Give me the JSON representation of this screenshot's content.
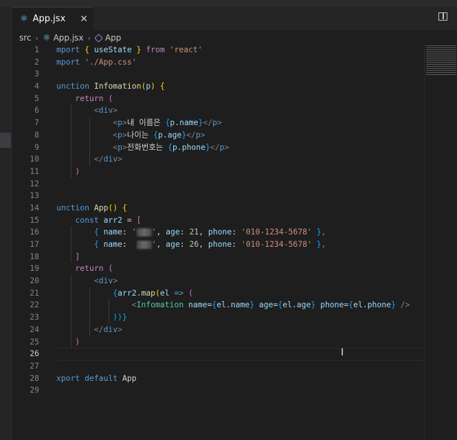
{
  "tab": {
    "icon": "react-icon",
    "label": "App.jsx",
    "close": "✕"
  },
  "breadcrumb": {
    "items": [
      "src",
      "App.jsx",
      "App"
    ]
  },
  "editor": {
    "lines": [
      {
        "num": "1",
        "tokens": [
          [
            "mport ",
            "kw"
          ],
          [
            "{ ",
            "brace"
          ],
          [
            "useState",
            "var"
          ],
          [
            " }",
            "brace"
          ],
          [
            " from ",
            "ctrl"
          ],
          [
            "'react'",
            "str"
          ]
        ]
      },
      {
        "num": "2",
        "tokens": [
          [
            "mport ",
            "kw"
          ],
          [
            "'./App.css'",
            "str"
          ]
        ]
      },
      {
        "num": "3",
        "tokens": []
      },
      {
        "num": "4",
        "tokens": [
          [
            "unction ",
            "kw"
          ],
          [
            "Infomation",
            "fn"
          ],
          [
            "(",
            "brace"
          ],
          [
            "p",
            "var"
          ],
          [
            ")",
            "brace"
          ],
          [
            " {",
            "brace"
          ]
        ]
      },
      {
        "num": "5",
        "tokens": [
          [
            "    return ",
            "ctrl"
          ],
          [
            "(",
            "brace2"
          ]
        ]
      },
      {
        "num": "6",
        "tokens": [
          [
            "        <",
            "punct"
          ],
          [
            "div",
            "tag"
          ],
          [
            ">",
            "punct"
          ]
        ]
      },
      {
        "num": "7",
        "tokens": [
          [
            "            <",
            "punct"
          ],
          [
            "p",
            "tag"
          ],
          [
            ">",
            "punct"
          ],
          [
            "내 이름은 ",
            "text"
          ],
          [
            "{",
            "brace3"
          ],
          [
            "p.name",
            "var"
          ],
          [
            "}",
            "brace3"
          ],
          [
            "</",
            "punct"
          ],
          [
            "p",
            "tag"
          ],
          [
            ">",
            "punct"
          ]
        ]
      },
      {
        "num": "8",
        "tokens": [
          [
            "            <",
            "punct"
          ],
          [
            "p",
            "tag"
          ],
          [
            ">",
            "punct"
          ],
          [
            "나이는 ",
            "text"
          ],
          [
            "{",
            "brace3"
          ],
          [
            "p.age",
            "var"
          ],
          [
            "}",
            "brace3"
          ],
          [
            "</",
            "punct"
          ],
          [
            "p",
            "tag"
          ],
          [
            ">",
            "punct"
          ]
        ]
      },
      {
        "num": "9",
        "tokens": [
          [
            "            <",
            "punct"
          ],
          [
            "p",
            "tag"
          ],
          [
            ">",
            "punct"
          ],
          [
            "전화번호는 ",
            "text"
          ],
          [
            "{",
            "brace3"
          ],
          [
            "p.phone",
            "var"
          ],
          [
            "}",
            "brace3"
          ],
          [
            "</",
            "punct"
          ],
          [
            "p",
            "tag"
          ],
          [
            ">",
            "punct"
          ]
        ]
      },
      {
        "num": "10",
        "tokens": [
          [
            "        </",
            "punct"
          ],
          [
            "div",
            "tag"
          ],
          [
            ">",
            "punct"
          ]
        ]
      },
      {
        "num": "11",
        "tokens": [
          [
            "    )",
            "brace2"
          ]
        ]
      },
      {
        "num": "12",
        "tokens": []
      },
      {
        "num": "13",
        "tokens": []
      },
      {
        "num": "14",
        "tokens": [
          [
            "unction ",
            "kw"
          ],
          [
            "App",
            "fn"
          ],
          [
            "()",
            "brace"
          ],
          [
            " {",
            "brace"
          ]
        ]
      },
      {
        "num": "15",
        "tokens": [
          [
            "    const ",
            "kw"
          ],
          [
            "arr2",
            "var"
          ],
          [
            " = ",
            "text"
          ],
          [
            "[",
            "brace2"
          ]
        ]
      },
      {
        "num": "16",
        "tokens": [
          [
            "        { ",
            "brace3"
          ],
          [
            "name",
            "var"
          ],
          [
            ": ",
            "text"
          ],
          [
            "'",
            "str"
          ],
          [
            "BLUR",
            "blur"
          ],
          [
            "'",
            "str"
          ],
          [
            ", ",
            "text"
          ],
          [
            "age",
            "var"
          ],
          [
            ": ",
            "text"
          ],
          [
            "21",
            "num"
          ],
          [
            ", ",
            "text"
          ],
          [
            "phone",
            "var"
          ],
          [
            ": ",
            "text"
          ],
          [
            "'010-1234-5678'",
            "str"
          ],
          [
            " },",
            "brace3"
          ]
        ]
      },
      {
        "num": "17",
        "tokens": [
          [
            "        { ",
            "brace3"
          ],
          [
            "name",
            "var"
          ],
          [
            ":  ",
            "text"
          ],
          [
            "BLUR",
            "blur"
          ],
          [
            "'",
            "str"
          ],
          [
            ", ",
            "text"
          ],
          [
            "age",
            "var"
          ],
          [
            ": ",
            "text"
          ],
          [
            "26",
            "num"
          ],
          [
            ", ",
            "text"
          ],
          [
            "phone",
            "var"
          ],
          [
            ": ",
            "text"
          ],
          [
            "'010-1234-5678'",
            "str"
          ],
          [
            " },",
            "brace3"
          ]
        ]
      },
      {
        "num": "18",
        "tokens": [
          [
            "    ]",
            "brace2"
          ]
        ]
      },
      {
        "num": "19",
        "tokens": [
          [
            "    return ",
            "ctrl"
          ],
          [
            "(",
            "brace2"
          ]
        ]
      },
      {
        "num": "20",
        "tokens": [
          [
            "        <",
            "punct"
          ],
          [
            "div",
            "tag"
          ],
          [
            ">",
            "punct"
          ]
        ]
      },
      {
        "num": "21",
        "tokens": [
          [
            "            {",
            "brace3"
          ],
          [
            "arr2",
            "var"
          ],
          [
            ".",
            "text"
          ],
          [
            "map",
            "fn"
          ],
          [
            "(",
            "brace"
          ],
          [
            "el",
            "var"
          ],
          [
            " => ",
            "kw"
          ],
          [
            "(",
            "brace2"
          ]
        ]
      },
      {
        "num": "22",
        "tokens": [
          [
            "                <",
            "punct"
          ],
          [
            "Infomation",
            "comp"
          ],
          [
            " name",
            "var"
          ],
          [
            "=",
            "text"
          ],
          [
            "{",
            "brace3"
          ],
          [
            "el.name",
            "var"
          ],
          [
            "}",
            "brace3"
          ],
          [
            " age",
            "var"
          ],
          [
            "=",
            "text"
          ],
          [
            "{",
            "brace3"
          ],
          [
            "el.age",
            "var"
          ],
          [
            "}",
            "brace3"
          ],
          [
            " phone",
            "var"
          ],
          [
            "=",
            "text"
          ],
          [
            "{",
            "brace3"
          ],
          [
            "el.phone",
            "var"
          ],
          [
            "}",
            "brace3"
          ],
          [
            " />",
            "punct"
          ]
        ]
      },
      {
        "num": "23",
        "tokens": [
          [
            "            ))}",
            "brace3"
          ]
        ]
      },
      {
        "num": "24",
        "tokens": [
          [
            "        </",
            "punct"
          ],
          [
            "div",
            "tag"
          ],
          [
            ">",
            "punct"
          ]
        ]
      },
      {
        "num": "25",
        "tokens": [
          [
            "    )",
            "brace2"
          ]
        ]
      },
      {
        "num": "26",
        "tokens": [],
        "current": true
      },
      {
        "num": "27",
        "tokens": []
      },
      {
        "num": "28",
        "tokens": [
          [
            "xport ",
            "kw"
          ],
          [
            "default ",
            "kw"
          ],
          [
            "App",
            "text"
          ]
        ]
      },
      {
        "num": "29",
        "tokens": []
      }
    ]
  },
  "colors": {
    "background": "#1e1e1e",
    "tab_bar": "#252526",
    "accent_react": "#61dafb"
  }
}
